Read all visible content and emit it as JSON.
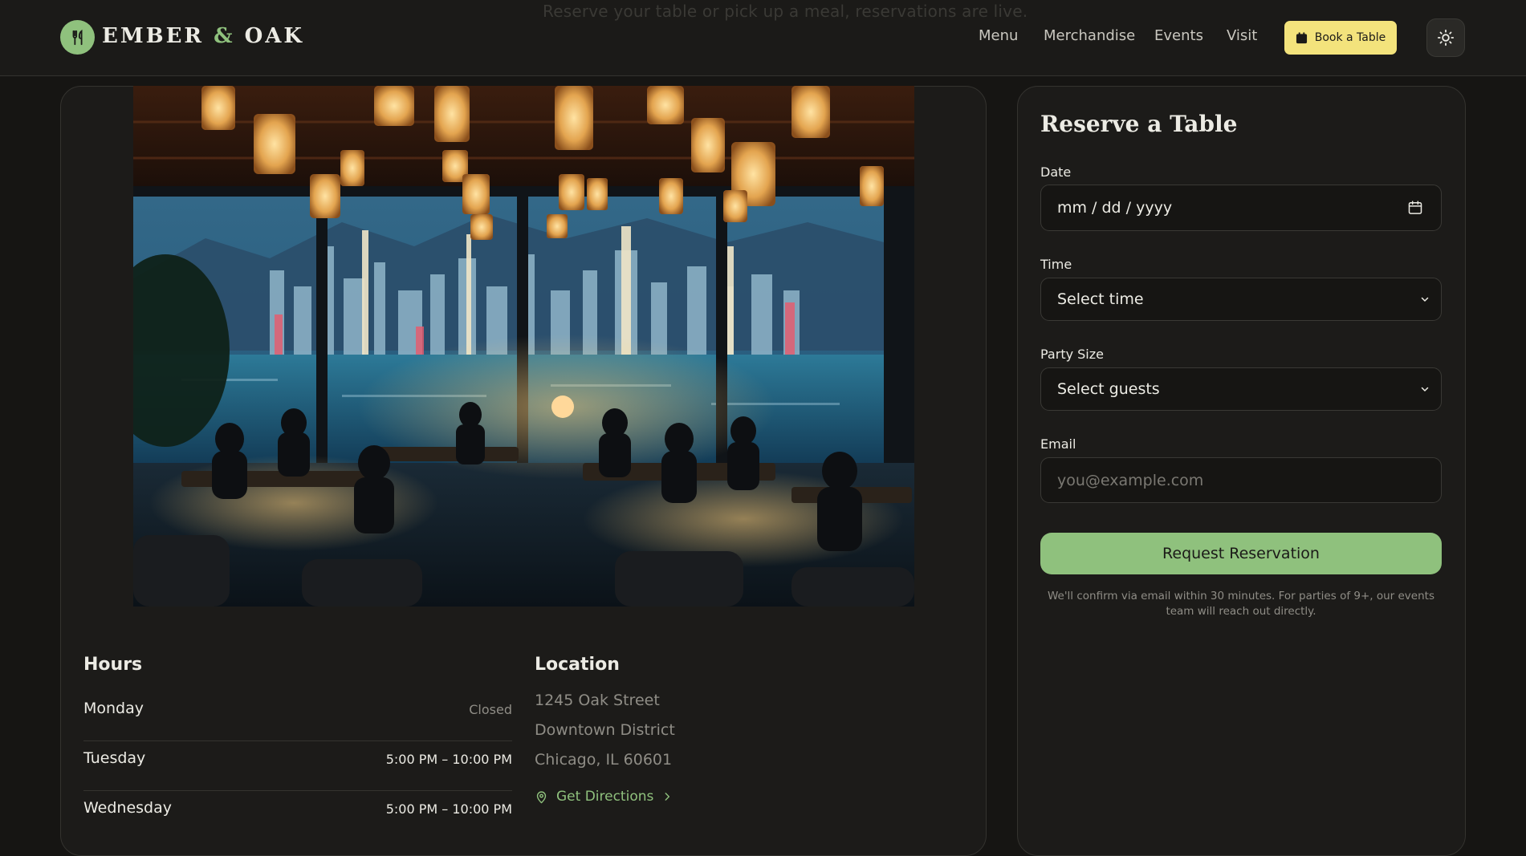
{
  "header": {
    "ghost_text": "Reserve your table or pick up a meal, reservations are live.",
    "brand": {
      "part1": "EMBER ",
      "amp": "&",
      "part2": " OAK"
    },
    "nav": [
      "Menu",
      "Merchandise",
      "Events",
      "Visit"
    ],
    "book_button": "Book a Table",
    "theme_toggle_icon": "sun-icon"
  },
  "hours": {
    "title": "Hours",
    "rows": [
      {
        "day": "Monday",
        "time": "Closed"
      },
      {
        "day": "Tuesday",
        "time": "5:00 PM – 10:00 PM"
      },
      {
        "day": "Wednesday",
        "time": "5:00 PM – 10:00 PM"
      }
    ]
  },
  "location": {
    "title": "Location",
    "lines": [
      "1245 Oak Street",
      "Downtown District",
      "Chicago, IL 60601"
    ],
    "directions": "Get Directions"
  },
  "reservation": {
    "title": "Reserve a Table",
    "date": {
      "label": "Date",
      "placeholder": "mm / dd / yyyy"
    },
    "time": {
      "label": "Time",
      "value": "Select time"
    },
    "party": {
      "label": "Party Size",
      "value": "Select guests"
    },
    "email": {
      "label": "Email",
      "placeholder": "you@example.com"
    },
    "submit": "Request Reservation",
    "note": "We'll confirm via email within 30 minutes. For parties of 9+, our events team will reach out directly."
  },
  "colors": {
    "background": "#161513",
    "accent_green": "#8fc17d",
    "accent_yellow": "#f3e37c",
    "muted_text": "#8f8d86"
  }
}
